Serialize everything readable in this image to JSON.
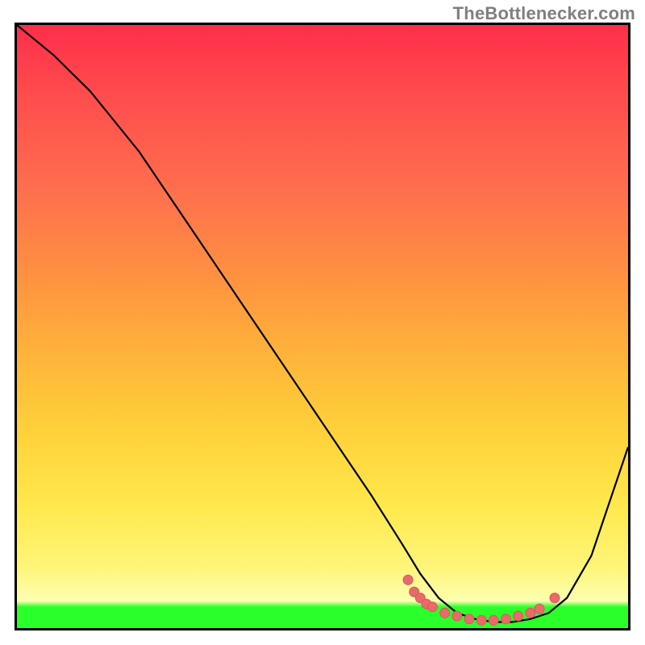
{
  "attribution": "TheBottlenecker.com",
  "chart_data": {
    "type": "line",
    "title": "",
    "xlabel": "",
    "ylabel": "",
    "xlim": [
      0,
      100
    ],
    "ylim": [
      0,
      100
    ],
    "grid": false,
    "legend": false,
    "series": [
      {
        "name": "bottleneck-curve",
        "x": [
          0,
          6,
          12,
          20,
          30,
          40,
          50,
          58,
          63,
          66,
          69,
          72,
          75,
          78,
          81,
          84,
          87,
          90,
          94,
          100
        ],
        "y": [
          100,
          95,
          89,
          79,
          64,
          49,
          34,
          22,
          14,
          9,
          5,
          2.5,
          1.5,
          1,
          1,
          1.5,
          2.5,
          5,
          12,
          30
        ]
      }
    ],
    "optimal_band_y": [
      0,
      3.5
    ],
    "markers": {
      "name": "optimal-range-markers",
      "points": [
        {
          "x": 64,
          "y": 8
        },
        {
          "x": 65,
          "y": 6
        },
        {
          "x": 66,
          "y": 5
        },
        {
          "x": 67,
          "y": 4
        },
        {
          "x": 68,
          "y": 3.5
        },
        {
          "x": 70,
          "y": 2.5
        },
        {
          "x": 72,
          "y": 2
        },
        {
          "x": 74,
          "y": 1.5
        },
        {
          "x": 76,
          "y": 1.3
        },
        {
          "x": 78,
          "y": 1.3
        },
        {
          "x": 80,
          "y": 1.5
        },
        {
          "x": 82,
          "y": 2
        },
        {
          "x": 84,
          "y": 2.5
        },
        {
          "x": 85.5,
          "y": 3.2
        },
        {
          "x": 88,
          "y": 5
        }
      ]
    },
    "gradient_semantics": {
      "top_color": "#ff2e4a",
      "mid_color": "#ffe94d",
      "bottom_band_color": "#2bff2b",
      "meaning": "red = high bottleneck, green = optimal"
    }
  }
}
